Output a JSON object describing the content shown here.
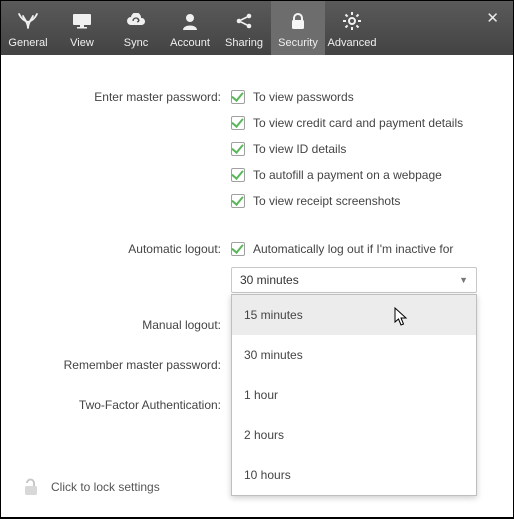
{
  "toolbar": {
    "tabs": [
      {
        "id": "general",
        "label": "General"
      },
      {
        "id": "view",
        "label": "View"
      },
      {
        "id": "sync",
        "label": "Sync"
      },
      {
        "id": "account",
        "label": "Account"
      },
      {
        "id": "sharing",
        "label": "Sharing"
      },
      {
        "id": "security",
        "label": "Security"
      },
      {
        "id": "advanced",
        "label": "Advanced"
      }
    ],
    "active_tab": "security",
    "close_glyph": "✕"
  },
  "labels": {
    "enter_master_password": "Enter master password:",
    "automatic_logout": "Automatic logout:",
    "manual_logout": "Manual logout:",
    "remember_master_password": "Remember master password:",
    "two_factor_auth": "Two-Factor Authentication:"
  },
  "master_password_checks": {
    "view_passwords": {
      "checked": true,
      "label": "To view passwords"
    },
    "view_credit": {
      "checked": true,
      "label": "To view credit card and payment details"
    },
    "view_id": {
      "checked": true,
      "label": "To view ID details"
    },
    "autofill_payment": {
      "checked": true,
      "label": "To autofill a payment on a webpage"
    },
    "view_receipt": {
      "checked": true,
      "label": "To view receipt screenshots"
    }
  },
  "auto_logout": {
    "checked": true,
    "label": "Automatically log out if I'm inactive for",
    "selected": "30 minutes",
    "options": [
      "15 minutes",
      "30 minutes",
      "1 hour",
      "2 hours",
      "10 hours"
    ],
    "hovered_option_index": 0
  },
  "footer": {
    "lock_text": "Click to lock settings"
  }
}
